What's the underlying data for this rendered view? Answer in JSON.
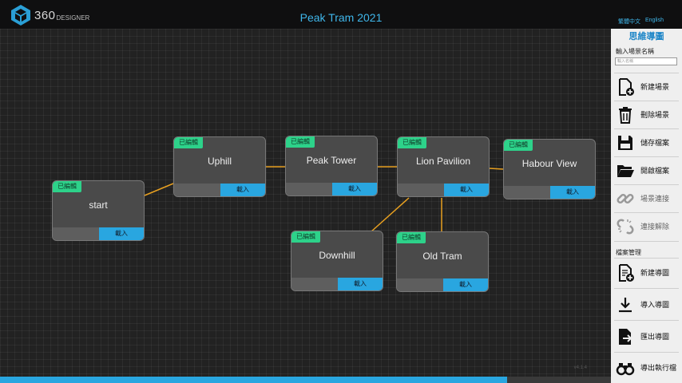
{
  "app": {
    "logo_text": "360",
    "logo_sub": "DESIGNER",
    "title": "Peak Tram 2021",
    "lang_tc": "繁體中文",
    "lang_en": "English",
    "version": "v4.1.4"
  },
  "progress": {
    "fraction": 0.83
  },
  "nodes": [
    {
      "tag": "已編輯",
      "name": "start",
      "load": "載入"
    },
    {
      "tag": "已編輯",
      "name": "Uphill",
      "load": "載入"
    },
    {
      "tag": "已編輯",
      "name": "Peak Tower",
      "load": "載入"
    },
    {
      "tag": "已編輯",
      "name": "Lion Pavilion",
      "load": "載入"
    },
    {
      "tag": "已編輯",
      "name": "Habour View",
      "load": "載入"
    },
    {
      "tag": "已編輯",
      "name": "Downhill",
      "load": "載入"
    },
    {
      "tag": "已編輯",
      "name": "Old Tram",
      "load": "載入"
    }
  ],
  "sidebar": {
    "title": "思維導圖",
    "scene_name_label": "輸入場景名稱",
    "scene_name_placeholder": "輸入名稱",
    "buttons": [
      {
        "label": "新建場景",
        "icon": "new-file-icon"
      },
      {
        "label": "刪除場景",
        "icon": "trash-icon"
      },
      {
        "label": "儲存檔案",
        "icon": "save-icon"
      },
      {
        "label": "開啟檔案",
        "icon": "folder-icon"
      },
      {
        "label": "場景連接",
        "icon": "link-icon"
      },
      {
        "label": "連接解除",
        "icon": "unlink-icon"
      }
    ],
    "file_section_label": "檔案管理",
    "file_buttons": [
      {
        "label": "新建導圖",
        "icon": "new-map-icon"
      },
      {
        "label": "導入導圖",
        "icon": "import-icon"
      },
      {
        "label": "匯出導圖",
        "icon": "export-icon"
      },
      {
        "label": "導出執行檔",
        "icon": "binoculars-icon"
      }
    ]
  },
  "colors": {
    "accent": "#29a6e0",
    "edited_tag": "#2dd28a",
    "link": "#e8a020"
  }
}
